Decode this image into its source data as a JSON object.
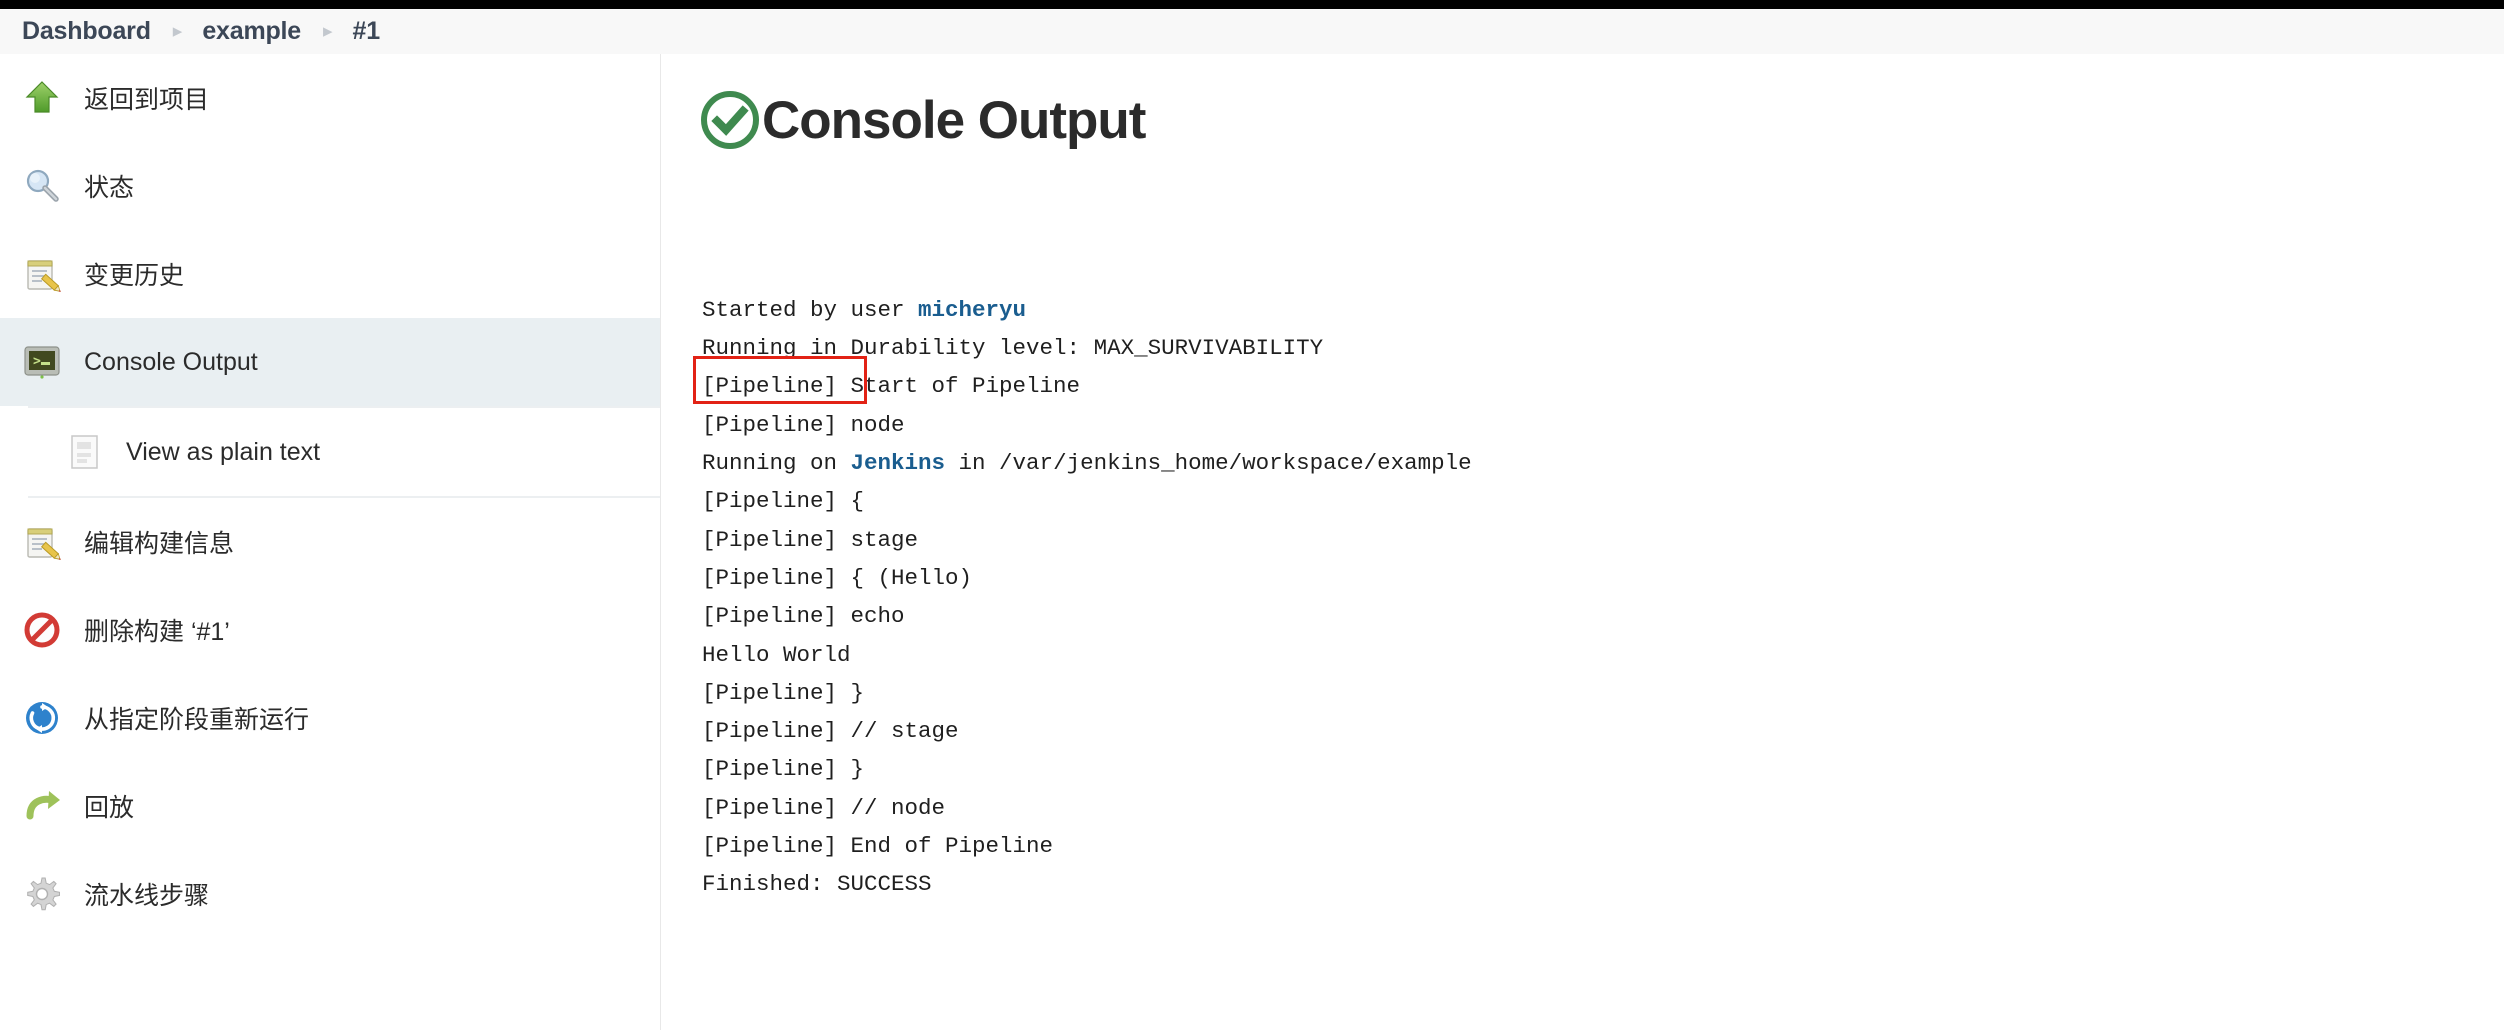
{
  "breadcrumb": {
    "items": [
      {
        "label": "Dashboard"
      },
      {
        "label": "example"
      },
      {
        "label": "#1"
      }
    ],
    "separator": "▸"
  },
  "sidebar": {
    "items": [
      {
        "label": "返回到项目",
        "icon": "up-arrow-icon",
        "active": false,
        "sub": false
      },
      {
        "label": "状态",
        "icon": "magnifier-icon",
        "active": false,
        "sub": false
      },
      {
        "label": "变更历史",
        "icon": "notepad-pencil-icon",
        "active": false,
        "sub": false
      },
      {
        "label": "Console Output",
        "icon": "terminal-icon",
        "active": true,
        "sub": false
      },
      {
        "label": "View as plain text",
        "icon": "document-icon",
        "active": false,
        "sub": true
      },
      {
        "label": "编辑构建信息",
        "icon": "notepad-pencil-icon",
        "active": false,
        "sub": false
      },
      {
        "label": "删除构建 ‘#1’",
        "icon": "no-entry-icon",
        "active": false,
        "sub": false
      },
      {
        "label": "从指定阶段重新运行",
        "icon": "restart-circle-icon",
        "active": false,
        "sub": false
      },
      {
        "label": "回放",
        "icon": "replay-arrow-icon",
        "active": false,
        "sub": false
      },
      {
        "label": "流水线步骤",
        "icon": "gear-icon",
        "active": false,
        "sub": false
      }
    ]
  },
  "main": {
    "title": "Console Output",
    "status_icon": "success-check-icon",
    "status_color": "#3f8a4f",
    "highlight_color": "#e22215",
    "log": [
      {
        "segments": [
          {
            "text": "Started by user ",
            "style": "normal"
          },
          {
            "text": "micheryu",
            "style": "link"
          }
        ]
      },
      {
        "segments": [
          {
            "text": "Running in Durability level: MAX_SURVIVABILITY",
            "style": "normal"
          }
        ]
      },
      {
        "segments": [
          {
            "text": "[Pipeline] Start of Pipeline",
            "style": "dim"
          }
        ]
      },
      {
        "segments": [
          {
            "text": "[Pipeline] node",
            "style": "dim"
          }
        ]
      },
      {
        "segments": [
          {
            "text": "Running on ",
            "style": "normal"
          },
          {
            "text": "Jenkins",
            "style": "link"
          },
          {
            "text": " in /var/jenkins_home/workspace/example",
            "style": "normal"
          }
        ]
      },
      {
        "segments": [
          {
            "text": "[Pipeline] {",
            "style": "dim"
          }
        ]
      },
      {
        "segments": [
          {
            "text": "[Pipeline] stage",
            "style": "dim"
          }
        ]
      },
      {
        "segments": [
          {
            "text": "[Pipeline] { (Hello)",
            "style": "dim"
          }
        ]
      },
      {
        "segments": [
          {
            "text": "[Pipeline] echo",
            "style": "dim"
          }
        ]
      },
      {
        "segments": [
          {
            "text": "Hello World",
            "style": "normal"
          }
        ]
      },
      {
        "segments": [
          {
            "text": "[Pipeline] }",
            "style": "dim"
          }
        ]
      },
      {
        "segments": [
          {
            "text": "[Pipeline] // stage",
            "style": "dim"
          }
        ]
      },
      {
        "segments": [
          {
            "text": "[Pipeline] }",
            "style": "dim"
          }
        ]
      },
      {
        "segments": [
          {
            "text": "[Pipeline] // node",
            "style": "dim"
          }
        ]
      },
      {
        "segments": [
          {
            "text": "[Pipeline] End of Pipeline",
            "style": "dim"
          }
        ]
      },
      {
        "segments": [
          {
            "text": "Finished: SUCCESS",
            "style": "normal"
          }
        ]
      }
    ]
  }
}
